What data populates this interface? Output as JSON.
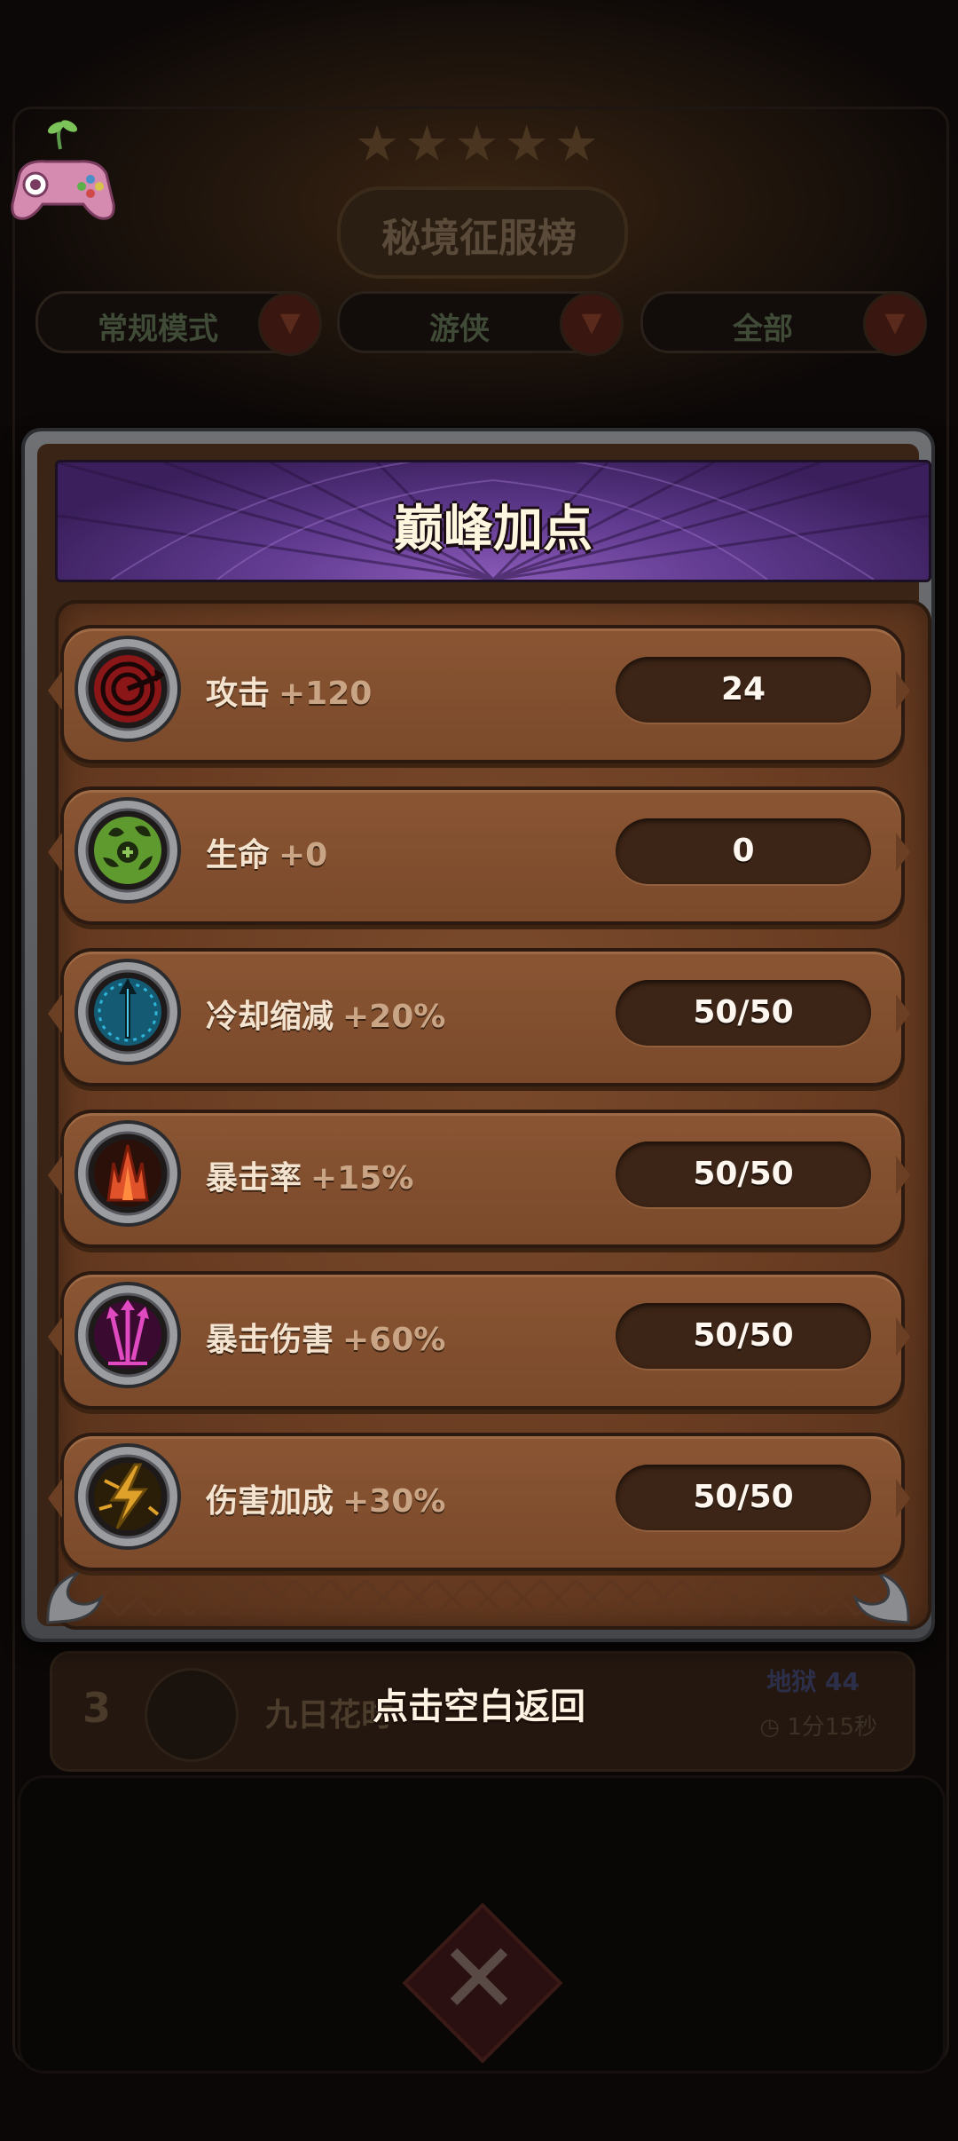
{
  "background": {
    "leaderboard_title": "秘境征服榜",
    "filters": [
      {
        "label": "常规模式"
      },
      {
        "label": "游侠"
      },
      {
        "label": "全部"
      }
    ],
    "ranking_row": {
      "rank": "3",
      "player_name": "九日花时",
      "zone": "地狱 44",
      "time": "◷ 1分15秒"
    }
  },
  "modal": {
    "title": "巅峰加点",
    "stats": [
      {
        "name": "攻击",
        "bonus": "+120",
        "value": "24",
        "icon": "attack-target-icon",
        "color": "#c0262b"
      },
      {
        "name": "生命",
        "bonus": "+0",
        "value": "0",
        "icon": "life-heart-icon",
        "color": "#6fae3a"
      },
      {
        "name": "冷却缩减",
        "bonus": "+20%",
        "value": "50/50",
        "icon": "cooldown-clock-icon",
        "color": "#2aa7c9"
      },
      {
        "name": "暴击率",
        "bonus": "+15%",
        "value": "50/50",
        "icon": "crit-rate-flame-icon",
        "color": "#e0522a"
      },
      {
        "name": "暴击伤害",
        "bonus": "+60%",
        "value": "50/50",
        "icon": "crit-damage-arrows-icon",
        "color": "#d43ab0"
      },
      {
        "name": "伤害加成",
        "bonus": "+30%",
        "value": "50/50",
        "icon": "damage-bonus-lightning-icon",
        "color": "#e0a12a"
      }
    ]
  },
  "close_hint": "点击空白返回"
}
